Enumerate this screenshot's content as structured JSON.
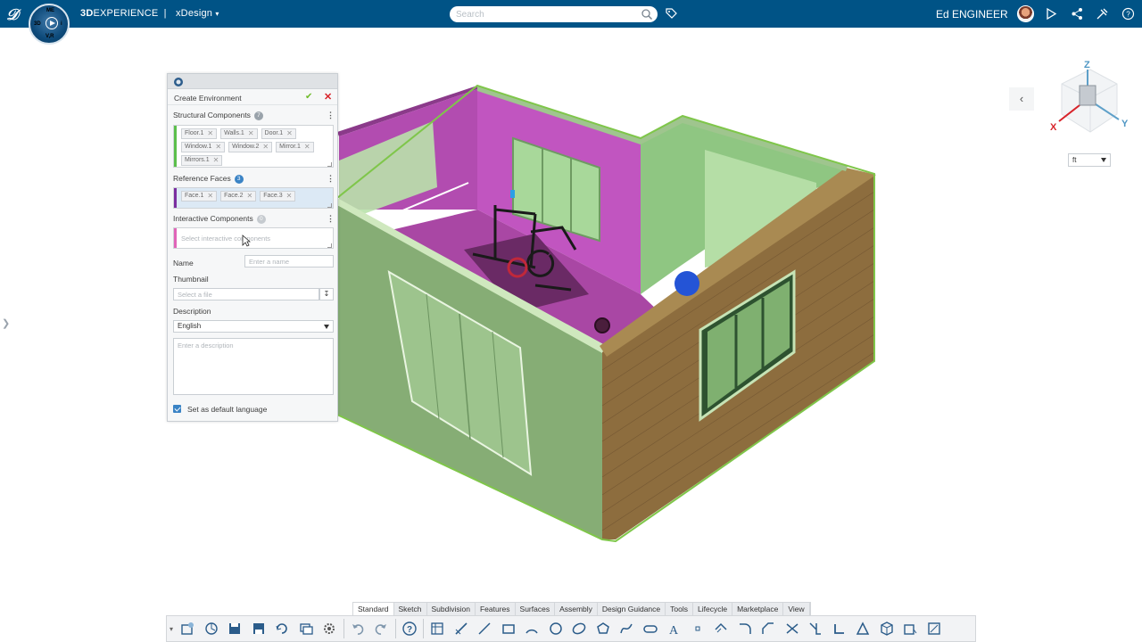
{
  "app": {
    "platform_light": "3D",
    "platform_bold": "EXPERIENCE",
    "separator": "|",
    "app_name": "xDesign",
    "compass": {
      "top": "ME",
      "left": "3D",
      "right": "i",
      "bottom": "V,R"
    }
  },
  "header": {
    "search_placeholder": "Search",
    "user_name": "Ed ENGINEER"
  },
  "panel": {
    "title": "Create Environment",
    "structural": {
      "label": "Structural Components",
      "count": "7",
      "chips": [
        "Floor.1",
        "Walls.1",
        "Door.1",
        "Window.1",
        "Window.2",
        "Mirror.1",
        "Mirrors.1"
      ],
      "accent": "#5bbf4b"
    },
    "reference": {
      "label": "Reference Faces",
      "count": "3",
      "chips": [
        "Face.1",
        "Face.2",
        "Face.3"
      ],
      "accent": "#7a2da0"
    },
    "interactive": {
      "label": "Interactive Components",
      "count": "0",
      "placeholder": "Select interactive components",
      "accent": "#e064b8"
    },
    "name_label": "Name",
    "name_placeholder": "Enter a name",
    "thumbnail_label": "Thumbnail",
    "thumbnail_placeholder": "Select a file",
    "description_label": "Description",
    "language": "English",
    "description_placeholder": "Enter a description",
    "default_language_label": "Set as default language"
  },
  "viewer": {
    "unit": "ft",
    "axes": {
      "x": "X",
      "y": "Y",
      "z": "Z"
    }
  },
  "action_bar": {
    "tabs": [
      "Standard",
      "Sketch",
      "Subdivision",
      "Features",
      "Surfaces",
      "Assembly",
      "Design Guidance",
      "Tools",
      "Lifecycle",
      "Marketplace",
      "View"
    ],
    "active_tab": "Standard",
    "tools": [
      "collaborate-icon",
      "open-icon",
      "save-icon",
      "save-as-icon",
      "refresh-icon",
      "layers-icon",
      "settings-icon",
      "undo-icon",
      "redo-icon",
      "help-icon",
      "table-icon",
      "sketch-icon",
      "line-icon",
      "rectangle-icon",
      "arc-icon",
      "circle-icon",
      "ellipse-icon",
      "polygon-icon",
      "spline-icon",
      "slot-icon",
      "text-icon",
      "point-icon",
      "offset-icon",
      "fillet-icon",
      "chamfer-icon",
      "trim-icon",
      "project-icon",
      "corner-icon",
      "construction-icon",
      "cube-icon",
      "extrude-icon",
      "drawing-icon"
    ]
  },
  "colors": {
    "topbar": "#005386",
    "walls_green": "#9ccf8e",
    "magenta": "#b94fb8",
    "brick": "#8a6a3c",
    "accent_blue": "#3a83c5"
  }
}
